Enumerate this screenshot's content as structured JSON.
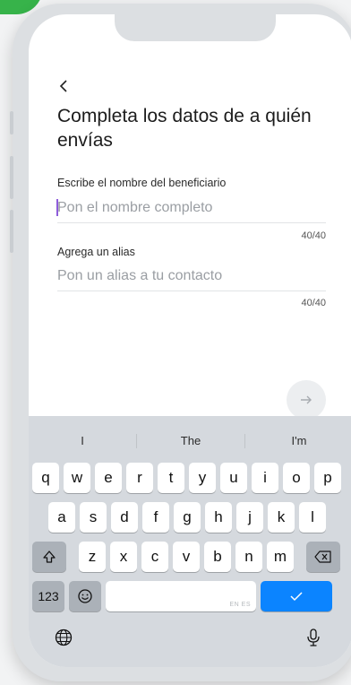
{
  "screen": {
    "title": "Completa los datos de a quién envías",
    "beneficiary": {
      "label": "Escribe el nombre del beneficiario",
      "placeholder": "Pon el nombre completo",
      "counter": "40/40"
    },
    "alias": {
      "label": "Agrega un alias",
      "placeholder": "Pon un alias a tu contacto",
      "counter": "40/40"
    }
  },
  "keyboard": {
    "suggestions": [
      "I",
      "The",
      "I'm"
    ],
    "row1": [
      "q",
      "w",
      "e",
      "r",
      "t",
      "y",
      "u",
      "i",
      "o",
      "p"
    ],
    "row2": [
      "a",
      "s",
      "d",
      "f",
      "g",
      "h",
      "j",
      "k",
      "l"
    ],
    "row3": [
      "z",
      "x",
      "c",
      "v",
      "b",
      "n",
      "m"
    ],
    "numbers_label": "123",
    "space_lang": "EN ES",
    "icons": {
      "back": "chevron-left-icon",
      "next": "arrow-right-icon",
      "shift": "shift-icon",
      "delete": "backspace-icon",
      "emoji": "emoji-icon",
      "done": "checkmark-icon",
      "globe": "globe-icon",
      "mic": "microphone-icon"
    }
  },
  "colors": {
    "accent": "#0b84ff",
    "brand": "#37b34a",
    "caret": "#8e5cdb"
  }
}
